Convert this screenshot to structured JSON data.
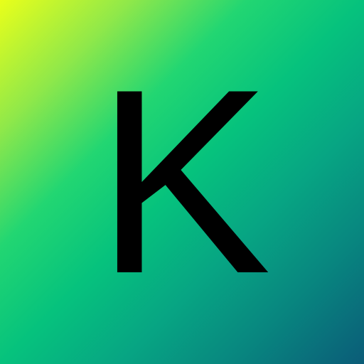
{
  "tile": {
    "letter": "K",
    "letter_color": "#000000",
    "gradient_colors": [
      "#e9ff1a",
      "#06c27d",
      "#0b5c78"
    ]
  }
}
